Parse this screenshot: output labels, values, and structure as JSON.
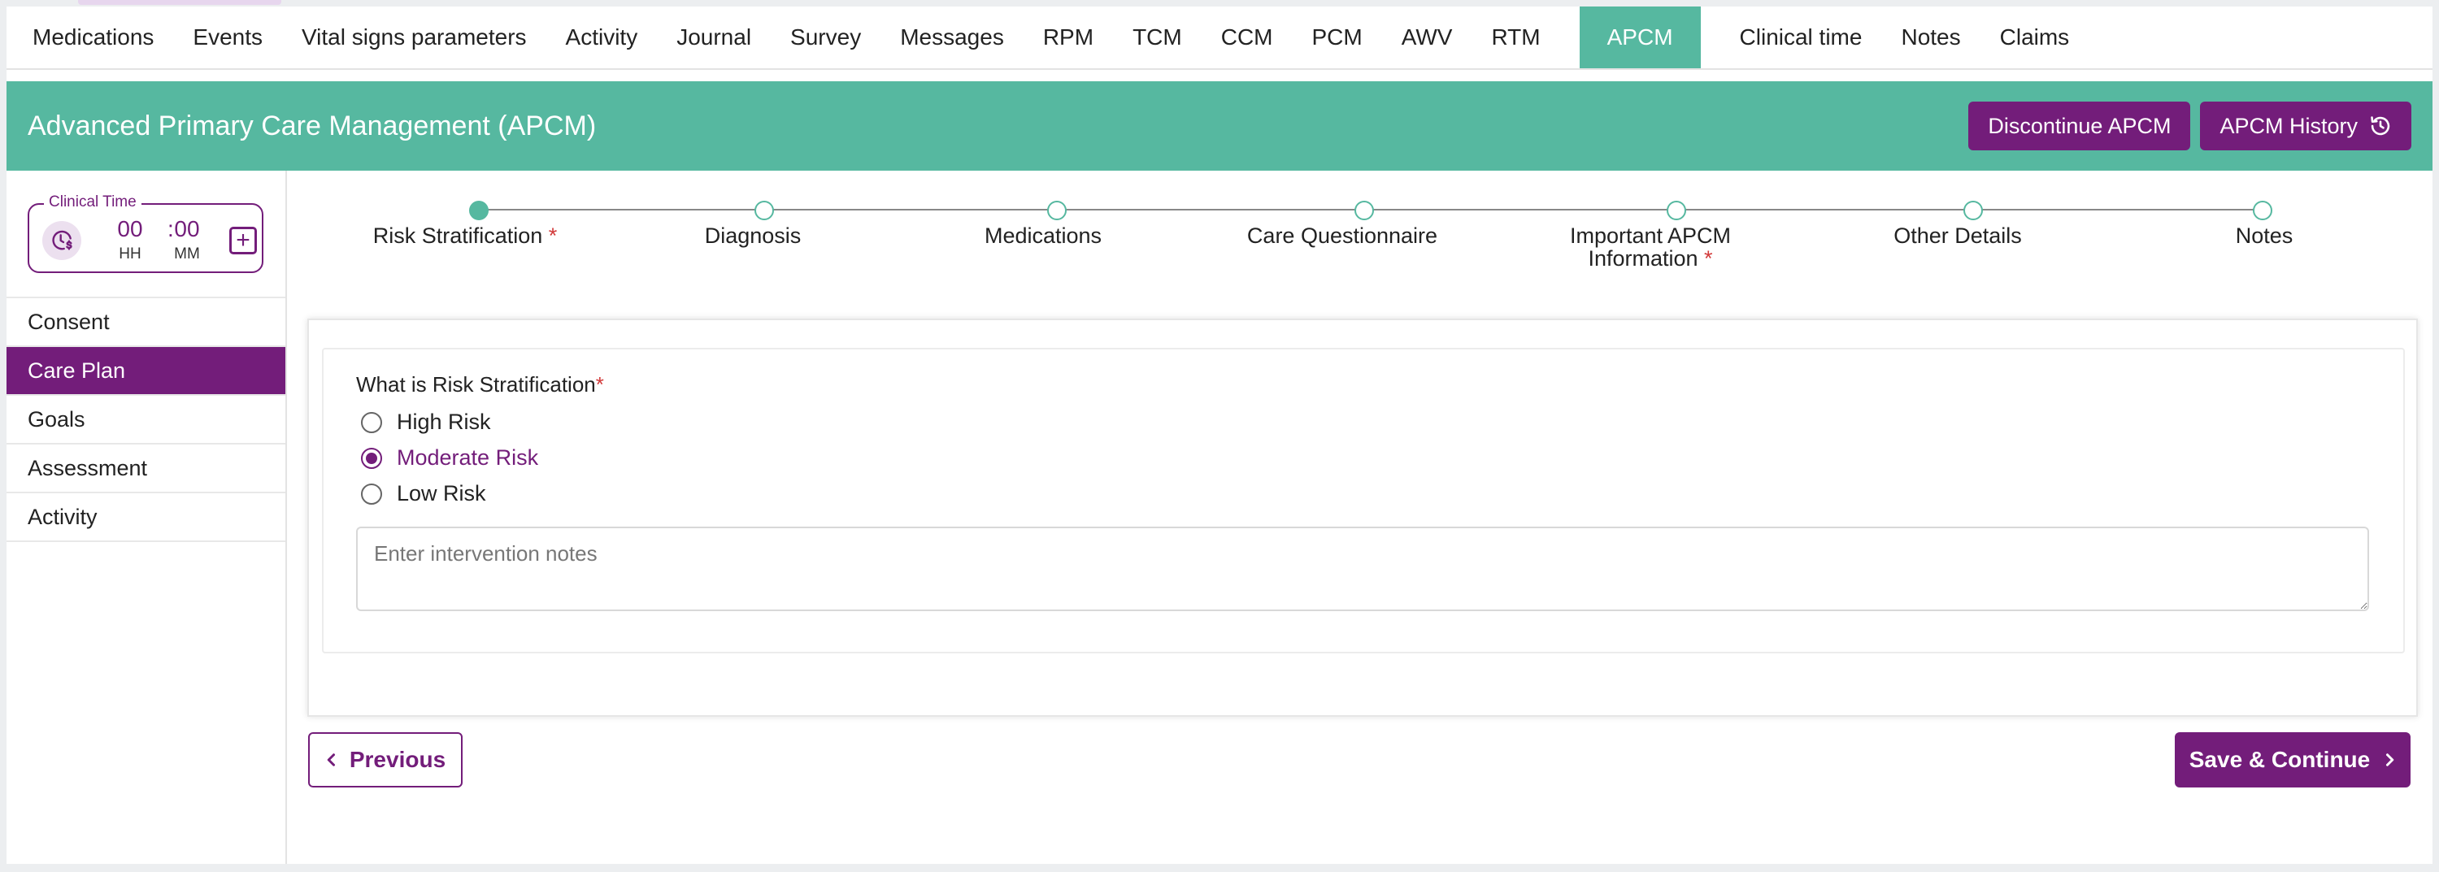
{
  "top_nav": {
    "tabs": [
      "Medications",
      "Events",
      "Vital signs parameters",
      "Activity",
      "Journal",
      "Survey",
      "Messages",
      "RPM",
      "TCM",
      "CCM",
      "PCM",
      "AWV",
      "RTM",
      "APCM",
      "Clinical time",
      "Notes",
      "Claims"
    ],
    "active": "APCM"
  },
  "header": {
    "title": "Advanced Primary Care Management (APCM)",
    "discontinue_label": "Discontinue APCM",
    "history_label": "APCM History"
  },
  "clinical_time": {
    "legend": "Clinical Time",
    "hours": "00",
    "minutes": "00",
    "hours_unit": "HH",
    "minutes_unit": "MM",
    "separator": ":"
  },
  "sidebar": {
    "items": [
      "Consent",
      "Care Plan",
      "Goals",
      "Assessment",
      "Activity"
    ],
    "active": "Care Plan"
  },
  "stepper": {
    "steps": [
      {
        "label": "Risk Stratification",
        "required": true,
        "label_line2": ""
      },
      {
        "label": "Diagnosis",
        "required": false,
        "label_line2": ""
      },
      {
        "label": "Medications",
        "required": false,
        "label_line2": ""
      },
      {
        "label": "Care Questionnaire",
        "required": false,
        "label_line2": ""
      },
      {
        "label": "Important APCM",
        "required": true,
        "label_line2": "Information"
      },
      {
        "label": "Other Details",
        "required": false,
        "label_line2": ""
      },
      {
        "label": "Notes",
        "required": false,
        "label_line2": ""
      }
    ],
    "current_step": 1
  },
  "form": {
    "question": "What is Risk Stratification",
    "required_mark": "*",
    "options": [
      "High Risk",
      "Moderate Risk",
      "Low Risk"
    ],
    "selected": "Moderate Risk",
    "notes_placeholder": "Enter intervention notes"
  },
  "footer": {
    "previous_label": "Previous",
    "save_label": "Save & Continue"
  },
  "colors": {
    "teal": "#56b8a0",
    "purple": "#731d7a",
    "required": "#d23a3a"
  },
  "icons": {
    "history": "history-icon",
    "clock": "clock-dollar-icon",
    "add": "plus-square-icon",
    "prev": "chevron-left-icon",
    "next": "chevron-right-icon"
  }
}
